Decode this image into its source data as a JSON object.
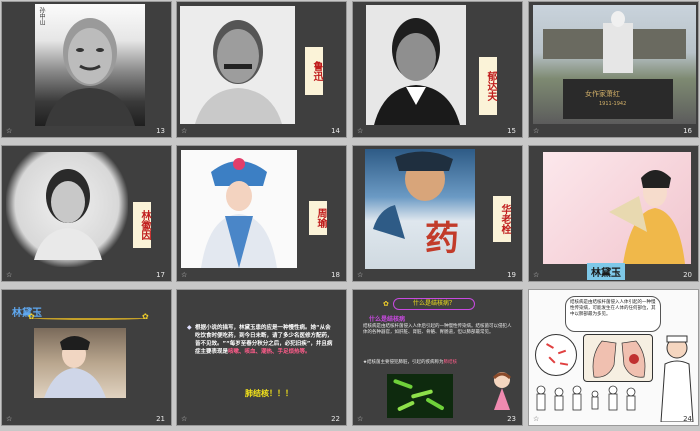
{
  "slides": [
    {
      "num": "13",
      "caption": "孙中山"
    },
    {
      "num": "14",
      "label": "鲁迅"
    },
    {
      "num": "15",
      "label": "郁达夫"
    },
    {
      "num": "16",
      "caption": "女作家萧红",
      "dates": "1911-1942"
    },
    {
      "num": "17",
      "label": "林徽因"
    },
    {
      "num": "18",
      "label": "周瑜"
    },
    {
      "num": "19",
      "label": "华老栓",
      "poster_title": "药"
    },
    {
      "num": "20",
      "label": "林黛玉"
    },
    {
      "num": "21",
      "title": "林黛玉"
    },
    {
      "num": "22",
      "text": "根据小说的描写，林黛玉患的应是一种慢性病。她“从会吃饮食时便吃药，到今日未断，请了多少名医修方配药，皆不见效。”“每岁至春分秋分之后，必犯旧疾”，并且病症主要表现是",
      "highlight": "咳嗽、咳血、潮热、手足烦热等。",
      "footer": "肺结核！！！"
    },
    {
      "num": "23",
      "title": "什么是结核病？",
      "subtitle": "什么是结核病",
      "text1": "结核病是由结核杆菌侵入人体后引起的一种慢性传染病。结核菌可以侵犯人体的各种器官，如肝脏、肾脏、骨骼、胃肠道，但以肺部最常见。",
      "text2": "★结核菌主要侵犯肺脏，引起的疾病称为",
      "highlight2": "肺结核"
    },
    {
      "num": "24",
      "bubble": "结核病是由结核杆菌侵入人体引起的一种慢性传染病，可能发生在人体的任何部位，其中以肺部最为多见。"
    }
  ]
}
